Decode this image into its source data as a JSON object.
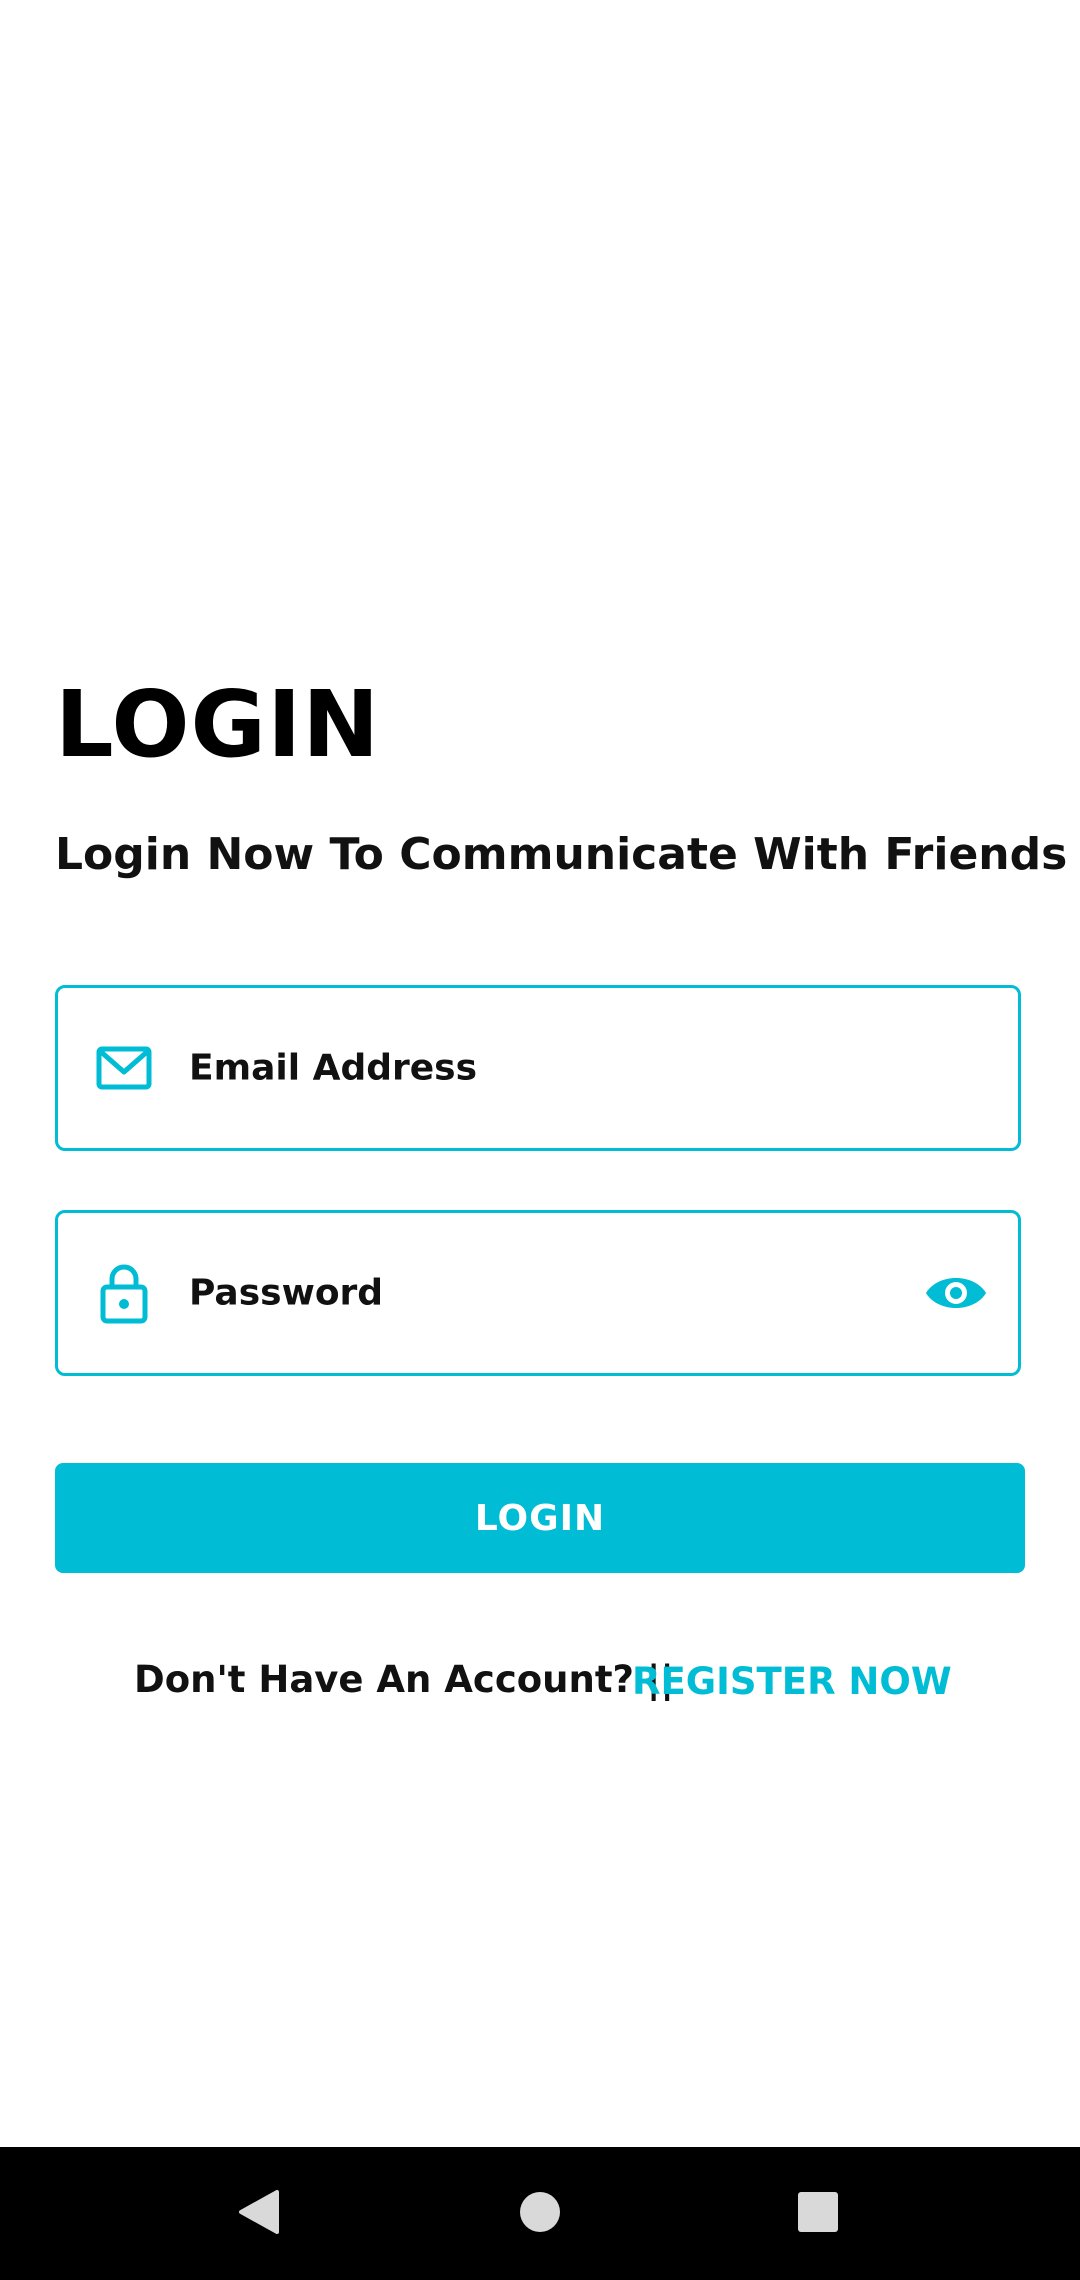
{
  "header": {
    "title": "LOGIN",
    "subtitle": "Login Now To Communicate With Friends"
  },
  "form": {
    "email": {
      "placeholder": "Email Address",
      "icon": "mail-icon"
    },
    "password": {
      "placeholder": "Password",
      "icon": "lock-icon",
      "toggle_icon": "eye-icon"
    },
    "submit_label": "LOGIN"
  },
  "footer": {
    "account_prompt": "Don't Have An Account? ||",
    "register_label": "REGISTER NOW"
  },
  "nav": {
    "back_icon": "back-triangle-icon",
    "home_icon": "home-circle-icon",
    "recents_icon": "recents-square-icon"
  },
  "colors": {
    "accent": "#00bcd4",
    "text": "#111111",
    "background": "#ffffff",
    "nav_background": "#000000"
  }
}
